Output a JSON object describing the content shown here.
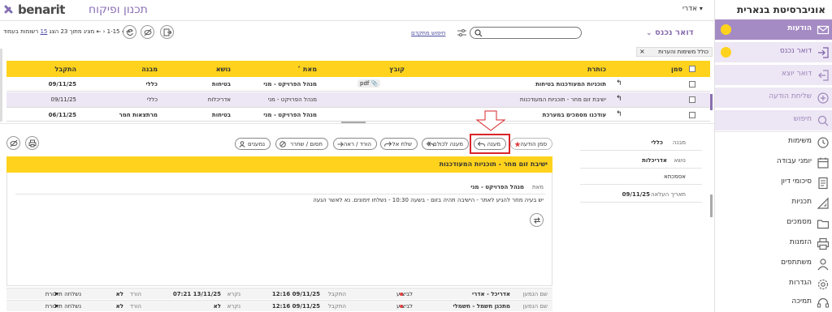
{
  "app": {
    "brand_name": "benarit",
    "brand_subtitle": "תכנון ופיקוח",
    "user_name": "אדרי",
    "university": "אוניברסיטת בנארית"
  },
  "sidebar": {
    "items": [
      {
        "label": "הודעות",
        "icon": "envelope-icon"
      },
      {
        "label": "דואר נכנס",
        "icon": "inbox-in-icon"
      },
      {
        "label": "דואר יוצא",
        "icon": "outbox-icon"
      },
      {
        "label": "שליחת הודעה",
        "icon": "plus-circle-icon"
      },
      {
        "label": "חיפוש",
        "icon": "search-icon"
      },
      {
        "label": "משימות",
        "icon": "clock-icon"
      },
      {
        "label": "יומני עבודה",
        "icon": "calendar-icon"
      },
      {
        "label": "סיכומי דיון",
        "icon": "notes-icon"
      },
      {
        "label": "תכניות",
        "icon": "ruler-triangle-icon"
      },
      {
        "label": "מסמכים",
        "icon": "folder-icon"
      },
      {
        "label": "הזמנות",
        "icon": "printer-icon"
      },
      {
        "label": "משתתפים",
        "icon": "user-icon"
      },
      {
        "label": "הגדרות",
        "icon": "gear-icon"
      },
      {
        "label": "תמיכה",
        "icon": "headset-icon"
      }
    ]
  },
  "toolbar": {
    "inbox_title": "דואר נכנס",
    "advanced_search": "חיפוש מתקדם",
    "search_placeholder": "",
    "pager_prefix": "מציג",
    "pager_range": "1-15",
    "pager_total_label": "מתוך 23",
    "pager_show_label": "הצג",
    "pager_page_size": "15",
    "pager_suffix": "רשומות בעמוד",
    "include_tasks_chip": "כולל משימות והערות"
  },
  "table": {
    "columns": [
      "סמן",
      "סימון",
      "כותרת",
      "קובץ",
      "מאת",
      "נושא",
      "מבנה",
      "התקבל"
    ],
    "rows": [
      {
        "title": "תוכניות המעודכנות בטיחות",
        "file": "pdf",
        "from": "מנהל הפרויקט - מני",
        "subject": "בטיחות",
        "building": "כללי",
        "received": "09/11/25",
        "selected": false
      },
      {
        "title": "ישיבת זום מחר - תוכניות המעודכנות",
        "file": "",
        "from": "מנהל הפרויקט - מני",
        "subject": "אדריכלות",
        "building": "כללי",
        "received": "09/11/25",
        "selected": true
      },
      {
        "title": "עודכנו מסמכים במערכת",
        "file": "",
        "from": "מנהל הפרויקט - מני",
        "subject": "בטיחות",
        "building": "מרתצאות חמר",
        "received": "06/11/25",
        "selected": false
      }
    ]
  },
  "details": {
    "building_label": "מבנה",
    "building_value": "כללי",
    "subject_label": "נושא",
    "subject_value": "אדריכלות",
    "sub_subject_value": "אסמכתא",
    "upload_date_label": "תאריך העלאה",
    "upload_date_value": "09/11/25"
  },
  "actions": {
    "mark_message": "סמן הודעה",
    "reply": "מענה",
    "reply_all": "מענה לכולם",
    "forward": "שלח אל",
    "download_view": "הורד / ראה",
    "lock_unlock": "חסום / שחרר",
    "recipients": "נמענים"
  },
  "message": {
    "title": "ישיבת זום מחר - תוכניות המעודכנות",
    "from_label": "מאת",
    "from_value": "מנהל הפרויקט - מני",
    "body": "יש בעיה מחר להגיע לאתר - הישיבה תהיה בזום - בשעה 10:30 - נשלחו זימונים. נא לאשר הגעה"
  },
  "recipients_rows": [
    {
      "name_label": "שם הנמען",
      "name": "אדריכל - אדרי",
      "status": "לביצוע",
      "received_label": "התקבל",
      "received": "09/11/25 12:16",
      "read_label": "נקרא",
      "read": "13/11/25 07:21",
      "download_label": "הורד",
      "download": "לא",
      "reminder": "נשלחה תזכורת"
    },
    {
      "name_label": "שם הנמען",
      "name": "מתכנן חשמל - חשמלי",
      "status": "לביצוע",
      "received_label": "התקבל",
      "received": "09/11/25 12:16",
      "read_label": "נקרא",
      "read": "לא",
      "download_label": "הורד",
      "download": "לא",
      "reminder": "נשלחה תזכורת"
    }
  ],
  "colors": {
    "accent_purple": "#a58bc4",
    "header_yellow": "#ffd31d",
    "selected_row": "#ede6f4",
    "highlight_red": "#d9252a"
  }
}
